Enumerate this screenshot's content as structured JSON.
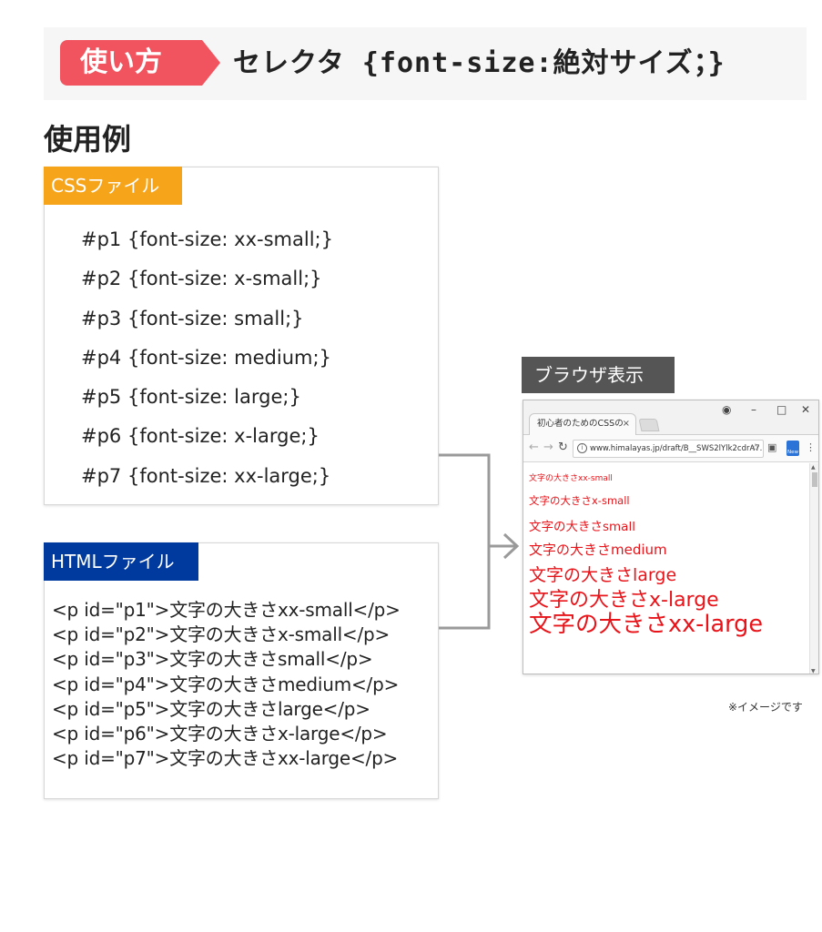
{
  "header": {
    "badge": "使い方",
    "syntax": "セレクタ {font-size:絶対サイズ；}"
  },
  "section_title": "使用例",
  "css_file": {
    "tab": "CSSファイル",
    "color": "#f6a41a",
    "lines": [
      "#p1 {font-size: xx-small;}",
      "#p2 {font-size: x-small;}",
      "#p3 {font-size: small;}",
      "#p4 {font-size: medium;}",
      "#p5 {font-size: large;}",
      "#p6 {font-size: x-large;}",
      "#p7 {font-size: xx-large;}"
    ]
  },
  "html_file": {
    "tab": "HTMLファイル",
    "color": "#003a9e",
    "lines": [
      "<p id=\"p1\">文字の大きさxx-small</p>",
      "<p id=\"p2\">文字の大きさx-small</p>",
      "<p id=\"p3\">文字の大きさsmall</p>",
      "<p id=\"p4\">文字の大きさmedium</p>",
      "<p id=\"p5\">文字の大きさlarge</p>",
      "<p id=\"p6\">文字の大きさx-large</p>",
      "<p id=\"p7\">文字の大きさxx-large</p>"
    ]
  },
  "browser": {
    "label": "ブラウザ表示",
    "tab_title": "初心者のためのCSSの",
    "tab_close": "×",
    "url": "www.himalayas.jp/draft/B__SWS2lYlk2cdrA7...",
    "new_badge": "New",
    "text_color": "#e8141a",
    "lines": [
      "文字の大きさxx-small",
      "文字の大きさx-small",
      "文字の大きさsmall",
      "文字の大きさmedium",
      "文字の大きさlarge",
      "文字の大きさx-large",
      "文字の大きさxx-large"
    ]
  },
  "note": "※イメージです"
}
